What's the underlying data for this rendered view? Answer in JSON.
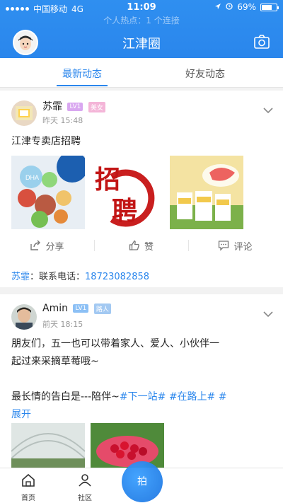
{
  "status_bar": {
    "carrier": "中国移动",
    "network": "4G",
    "time": "11:09",
    "battery": "69%",
    "battery_level": 0.69
  },
  "hotspot": {
    "text": "个人热点：1 个连接"
  },
  "header": {
    "title": "江津圈",
    "avatar_icon": "profile-avatar",
    "camera_icon": "camera-icon"
  },
  "tabs": [
    {
      "label": "最新动态",
      "active": true
    },
    {
      "label": "好友动态",
      "active": false
    }
  ],
  "posts": [
    {
      "user": "苏霏",
      "level": "LV1",
      "tag": "美女",
      "time": "昨天 15:48",
      "text": "江津专卖店招聘",
      "images": [
        "dha-diagram",
        "recruit-poster",
        "milk-powder-ad"
      ],
      "image_texts": {
        "dha": "DHA",
        "recruit_top": "招",
        "recruit_bottom": "聘"
      },
      "actions": {
        "share": "分享",
        "like": "赞",
        "comment": "评论"
      },
      "contact": {
        "nick": "苏霏",
        "label": "：联系电话：",
        "phone": "18723082858"
      }
    },
    {
      "user": "Amin",
      "level": "LV1",
      "tag": "路人",
      "time": "前天 18:15",
      "text_line1": "朋友们，五一也可以带着家人、爱人、小伙伴一",
      "text_line2": "起过来采摘草莓哦~",
      "text_line3_prefix": "最长情的告白是---陪伴~",
      "topic1": "#下一站#",
      "topic2": "#在路上#",
      "topic3": "#",
      "expand": "展开",
      "images": [
        "greenhouse",
        "strawberries"
      ]
    }
  ],
  "bottom_nav": {
    "home": "首页",
    "community": "社区",
    "fab_label": "拍"
  },
  "colors": {
    "primary": "#2a86ec",
    "background": "#f2f2f2"
  }
}
